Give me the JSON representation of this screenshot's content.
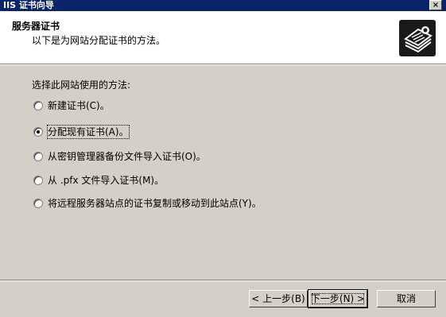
{
  "window": {
    "title": "IIS 证书向导",
    "close_label": "×"
  },
  "header": {
    "title": "服务器证书",
    "subtitle": "以下是为网站分配证书的方法。",
    "icon": "certificate-icon"
  },
  "main": {
    "prompt": "选择此网站使用的方法:",
    "options": [
      {
        "label": "新建证书(C)。",
        "checked": false
      },
      {
        "label": "分配现有证书(A)。",
        "checked": true
      },
      {
        "label": "从密钥管理器备份文件导入证书(O)。",
        "checked": false
      },
      {
        "label": "从 .pfx 文件导入证书(M)。",
        "checked": false
      },
      {
        "label": "将远程服务器站点的证书复制或移动到此站点(Y)。",
        "checked": false
      }
    ]
  },
  "footer": {
    "back_label": "< 上一步(B)",
    "next_label": "下一步(N) >",
    "cancel_label": "取消"
  },
  "colors": {
    "titlebar": "#0a246a",
    "dialog": "#d4d0c8"
  }
}
